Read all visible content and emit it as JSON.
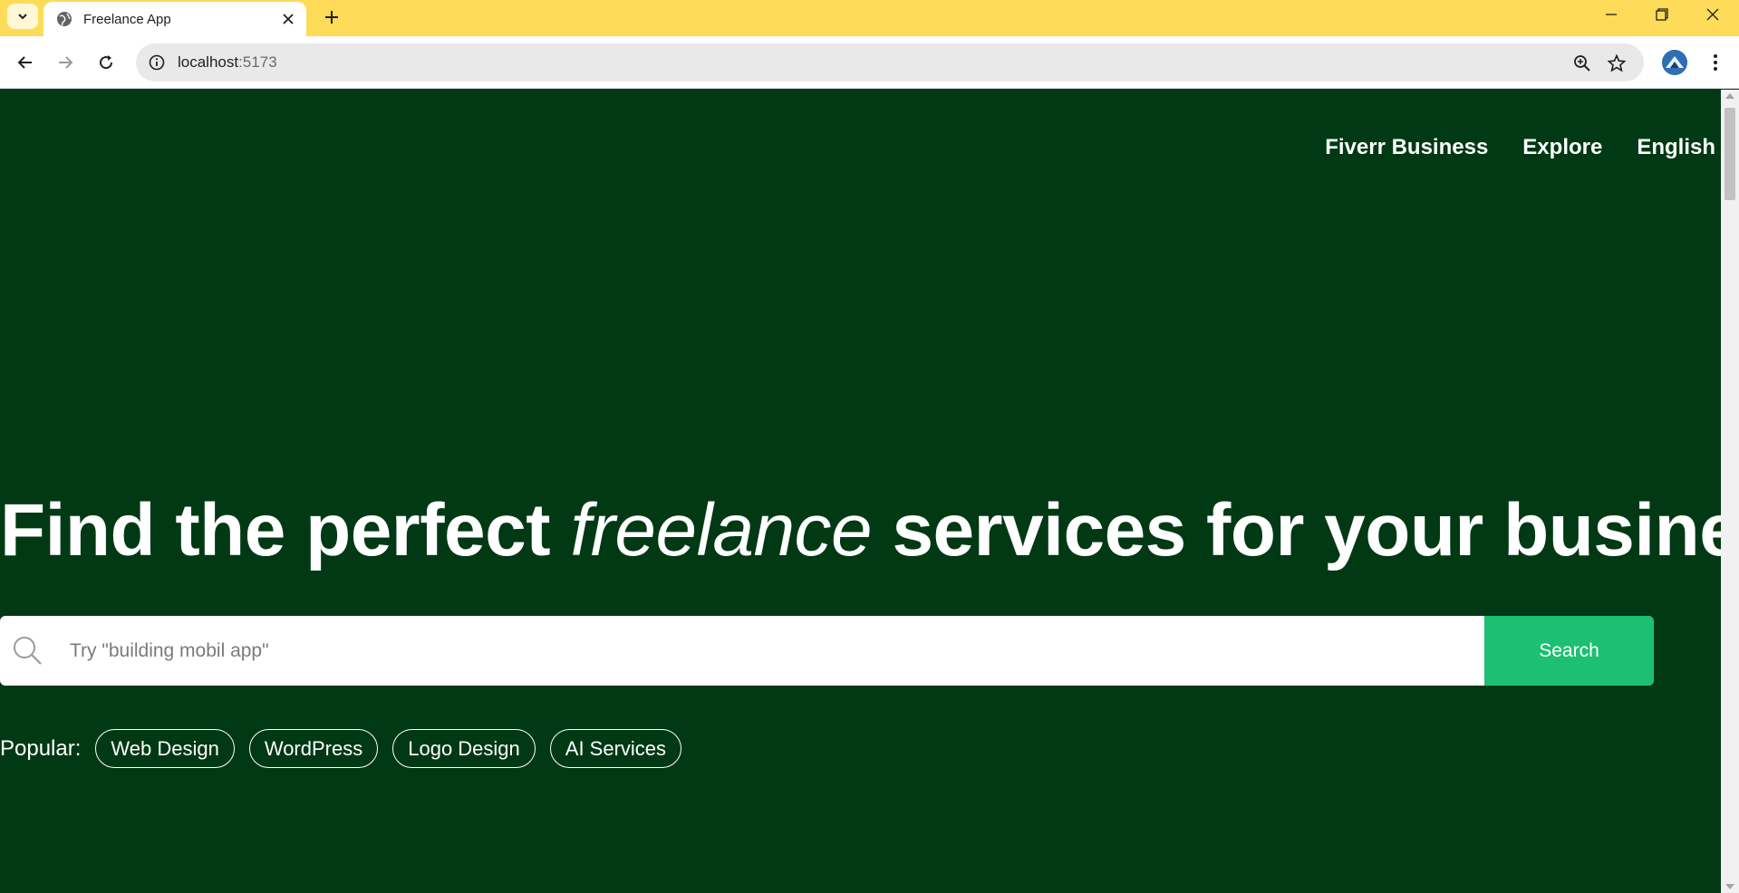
{
  "browser": {
    "tab_title": "Freelance App",
    "url_host": "localhost",
    "url_port": ":5173",
    "icons": {
      "tab_search": "chevron-down-icon",
      "favicon": "globe-icon",
      "tab_close": "close-icon",
      "new_tab": "plus-icon",
      "back": "back-arrow-icon",
      "forward": "forward-arrow-icon",
      "reload": "reload-icon",
      "site_info": "info-icon",
      "zoom": "zoom-icon",
      "bookmark": "star-icon",
      "profile": "avatar",
      "menu": "kebab-menu-icon"
    },
    "colors": {
      "tabstrip": "#fedc59",
      "toolbar": "#ffffff",
      "omnibox": "#e9e9e9"
    }
  },
  "page": {
    "nav": {
      "items": [
        "Fiverr Business",
        "Explore",
        "English"
      ]
    },
    "hero": {
      "title_before": "Find the perfect ",
      "title_italic": "freelance",
      "title_after": " services for your business"
    },
    "search": {
      "placeholder": "Try \"building mobil app\"",
      "value": "",
      "button_label": "Search"
    },
    "popular": {
      "label": "Popular:",
      "chips": [
        "Web Design",
        "WordPress",
        "Logo Design",
        "AI Services"
      ]
    },
    "colors": {
      "background": "#013914",
      "accent": "#1dbf73",
      "text": "#ffffff"
    }
  }
}
